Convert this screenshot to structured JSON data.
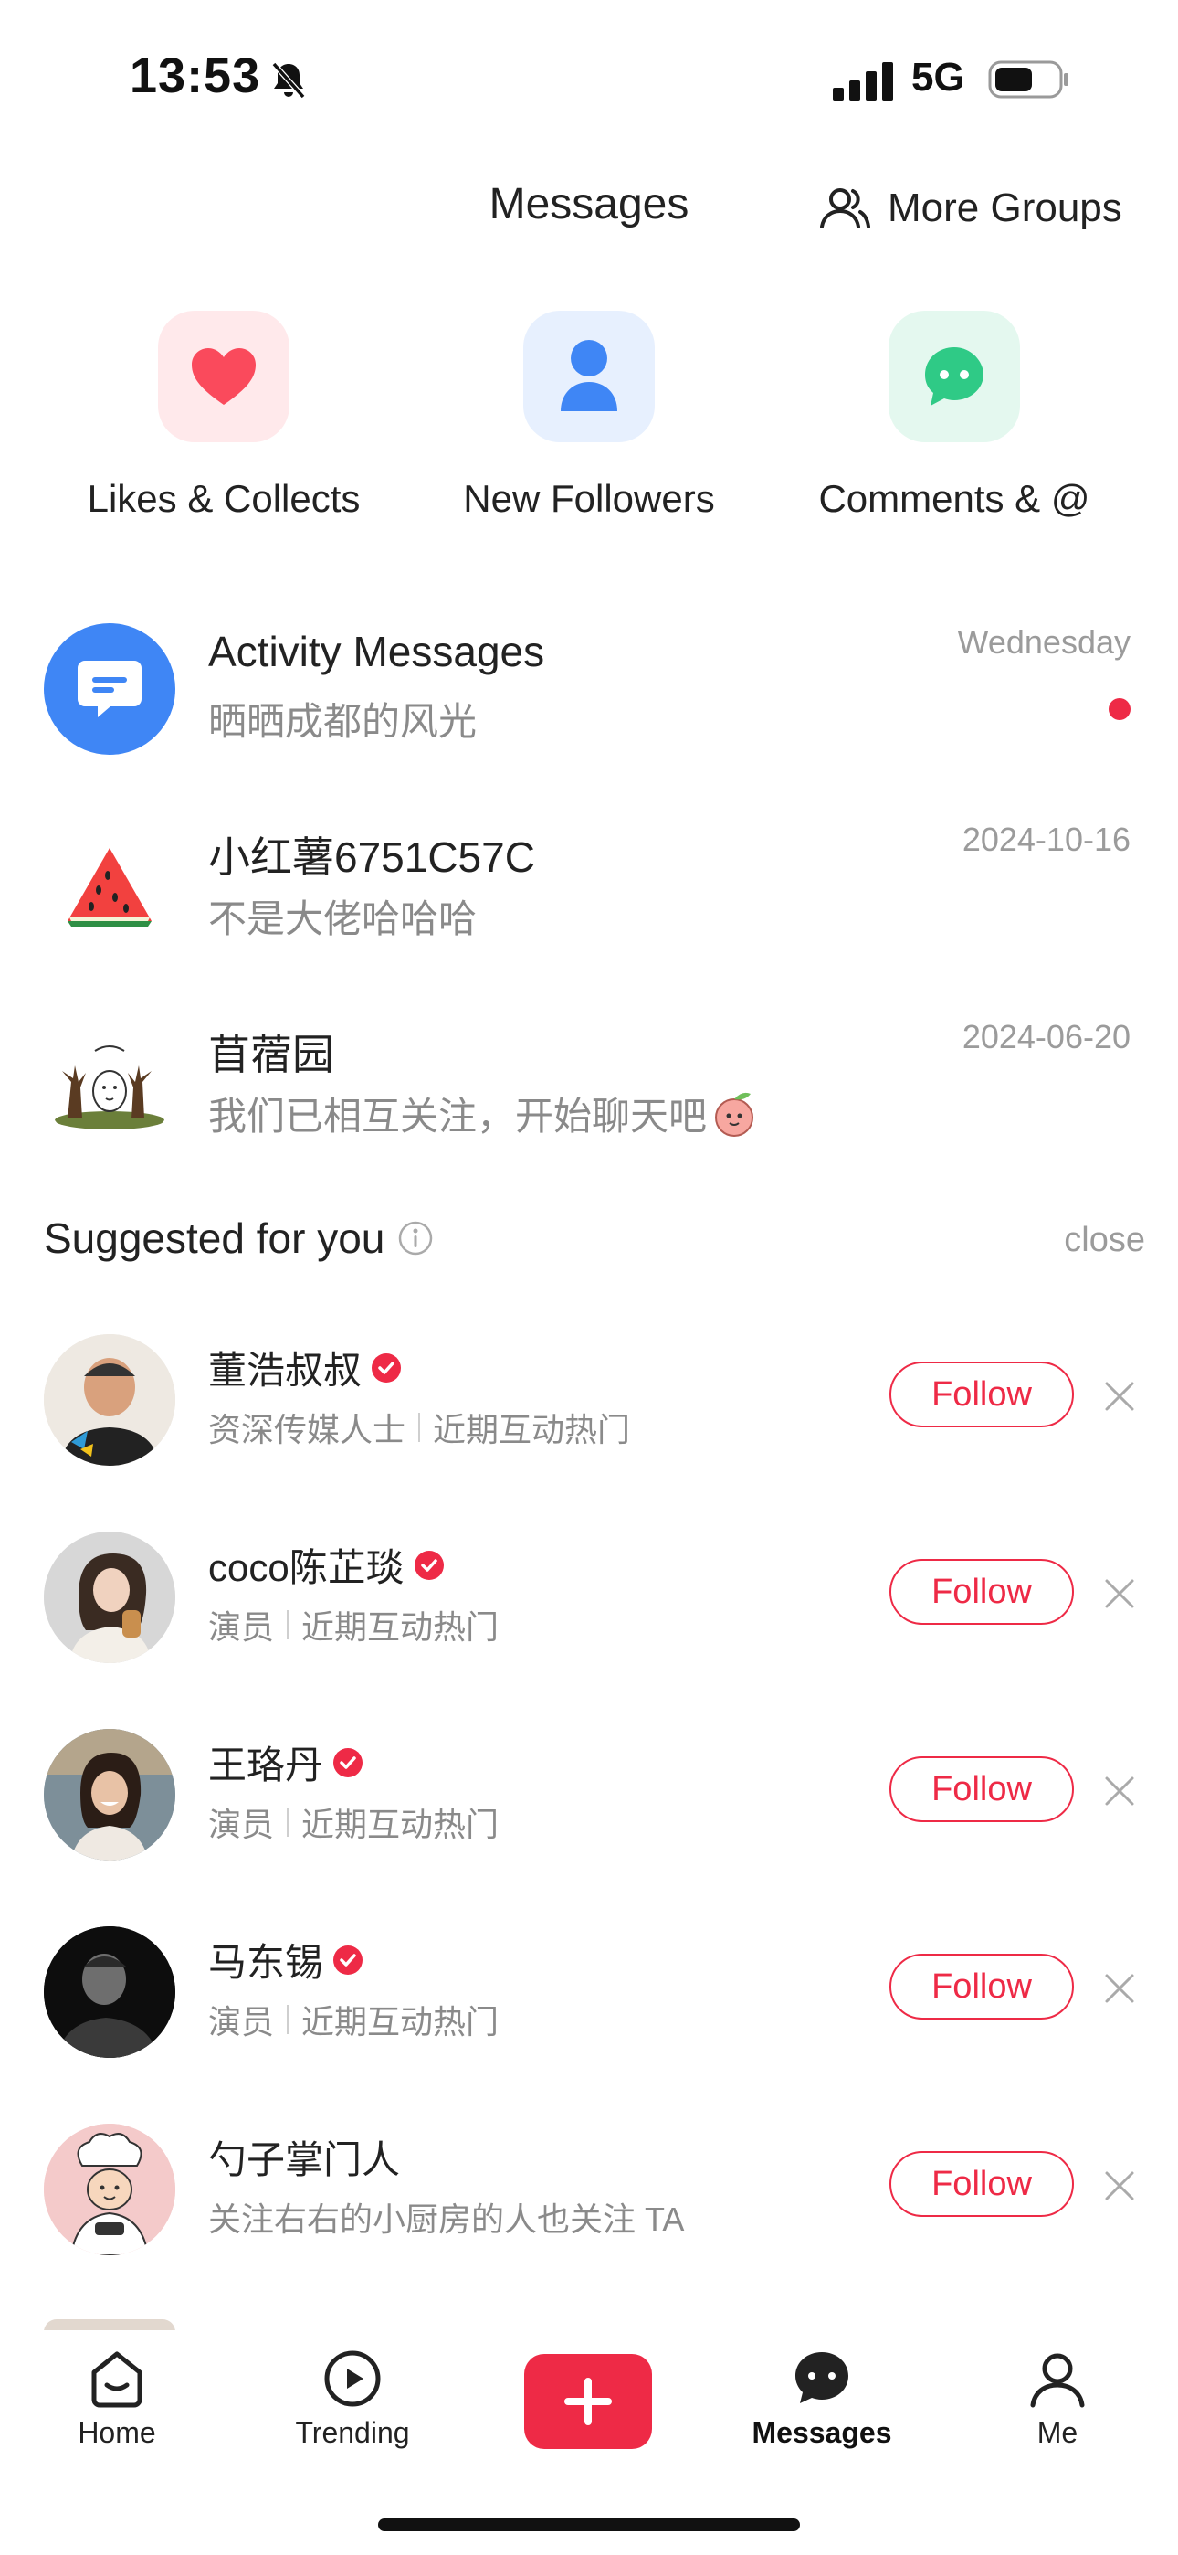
{
  "status_bar": {
    "time": "13:53",
    "network": "5G"
  },
  "header": {
    "title": "Messages",
    "more_groups_label": "More Groups"
  },
  "categories": [
    {
      "label": "Likes & Collects",
      "icon": "heart-icon",
      "color": "#fa4a5c",
      "bg": "#ffe9eb"
    },
    {
      "label": "New Followers",
      "icon": "person-icon",
      "color": "#3f86f5",
      "bg": "#e7f0fe"
    },
    {
      "label": "Comments & @",
      "icon": "chat-bubble-icon",
      "color": "#2fca86",
      "bg": "#e4f8ef"
    }
  ],
  "conversations": [
    {
      "title": "Activity Messages",
      "subtitle": "晒晒成都的风光",
      "date": "Wednesday",
      "unread": true,
      "avatar": "activity-icon"
    },
    {
      "title": "小红薯6751C57C",
      "subtitle": "不是大佬哈哈哈",
      "date": "2024-10-16",
      "unread": false,
      "avatar": "watermelon-avatar"
    },
    {
      "title": "苜蓿园",
      "subtitle": "我们已相互关注，开始聊天吧",
      "date": "2024-06-20",
      "unread": false,
      "avatar": "cartoon-avatar"
    }
  ],
  "suggestions": {
    "title": "Suggested for you",
    "close_label": "close",
    "items": [
      {
        "name": "董浩叔叔",
        "verified": true,
        "tag": "资深传媒人士",
        "reason": "近期互动热门",
        "follow_label": "Follow"
      },
      {
        "name": "coco陈芷琰",
        "verified": true,
        "tag": "演员",
        "reason": "近期互动热门",
        "follow_label": "Follow"
      },
      {
        "name": "王珞丹",
        "verified": true,
        "tag": "演员",
        "reason": "近期互动热门",
        "follow_label": "Follow"
      },
      {
        "name": "马东锡",
        "verified": true,
        "tag": "演员",
        "reason": "近期互动热门",
        "follow_label": "Follow"
      },
      {
        "name": "勺子掌门人",
        "verified": false,
        "tag": "关注右右的小厨房的人也关注 TA",
        "reason": "",
        "follow_label": "Follow"
      }
    ]
  },
  "tabbar": {
    "home": "Home",
    "trending": "Trending",
    "messages": "Messages",
    "me": "Me",
    "active": "Messages"
  },
  "colors": {
    "accent": "#ee2a46",
    "muted_text": "#8a8a8a"
  }
}
